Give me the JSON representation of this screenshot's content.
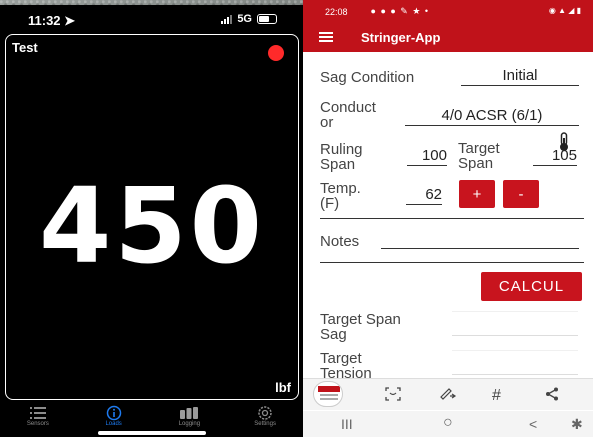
{
  "left_phone": {
    "status": {
      "time": "11:32",
      "network": "5G"
    },
    "card": {
      "title": "Test",
      "value": "450",
      "unit": "lbf",
      "indicator_color": "#ff2a2a"
    },
    "tabs": [
      {
        "label": "Sensors",
        "icon": "list-icon",
        "active": false
      },
      {
        "label": "Loads",
        "icon": "info-circle-icon",
        "active": true
      },
      {
        "label": "Logging",
        "icon": "bars-icon",
        "active": false
      },
      {
        "label": "Settings",
        "icon": "gear-icon",
        "active": false
      }
    ],
    "accent_color": "#1e7bf0"
  },
  "right_phone": {
    "status": {
      "time": "22:08"
    },
    "appbar": {
      "title": "Stringer-App",
      "color": "#c0121a"
    },
    "form": {
      "sag_condition_label": "Sag Condition",
      "sag_condition_value": "Initial",
      "conductor_label_1": "Conduct",
      "conductor_label_2": "or",
      "conductor_value": "4/0 ACSR (6/1)",
      "ruling_span_label_1": "Ruling",
      "ruling_span_label_2": "Span",
      "ruling_span_value": "100",
      "target_span_label_1": "Target",
      "target_span_label_2": "Span",
      "target_span_value": "105",
      "temp_label_1": "Temp.",
      "temp_label_2": "(F)",
      "temp_value": "62",
      "plus_label": "+",
      "minus_label": "-",
      "notes_label": "Notes",
      "calc_label": "CALCUL",
      "target_span_sag_label_1": "Target Span",
      "target_span_sag_label_2": "Sag",
      "target_tension_label_1": "Target",
      "target_tension_label_2": "Tension"
    },
    "toolbar": {
      "hash_label": "#"
    },
    "navbar": {
      "recents": "III",
      "home": "○",
      "back": "<"
    }
  }
}
